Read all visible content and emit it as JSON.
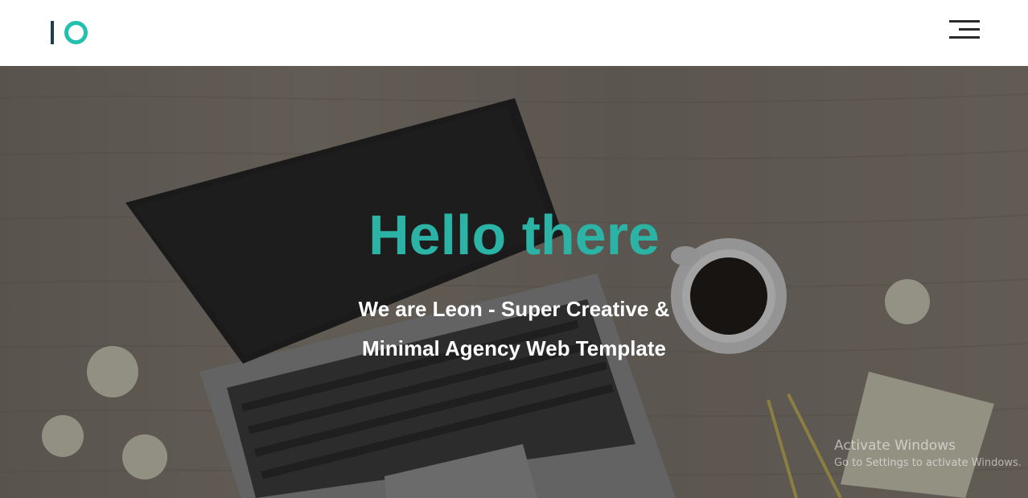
{
  "navbar": {
    "logo_icon": "io-logo-icon",
    "menu_icon": "hamburger-menu-icon",
    "colors": {
      "logo_bar": "#1d3f4b",
      "logo_ring": "#23c0ae",
      "menu": "#2b2b2b"
    }
  },
  "hero": {
    "title": "Hello there",
    "subtitle_line1": "We are Leon - Super Creative &",
    "subtitle_line2": "Minimal Agency Web Template",
    "title_color": "#2bb3a5"
  },
  "watermark": {
    "title": "Activate Windows",
    "subtitle": "Go to Settings to activate Windows."
  }
}
